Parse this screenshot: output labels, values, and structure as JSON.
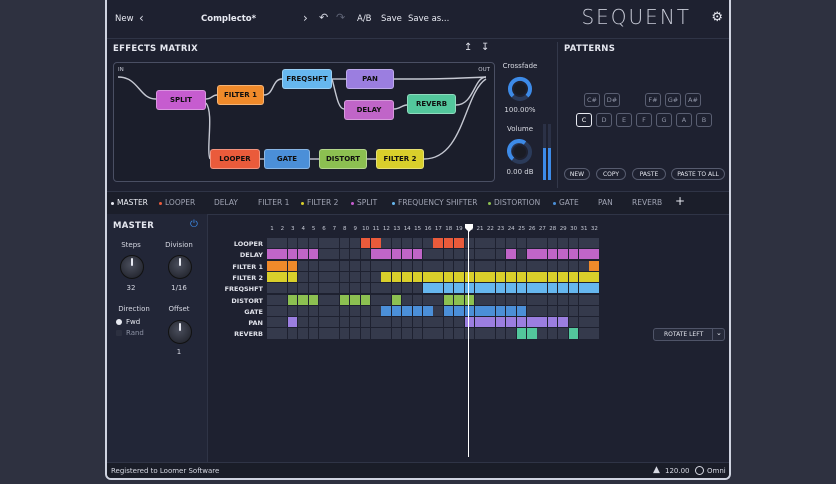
{
  "topbar": {
    "new_label": "New",
    "preset_name": "Complecto*",
    "ab_label": "A/B",
    "save_label": "Save",
    "save_as_label": "Save as...",
    "brand": "SEQUENT"
  },
  "effects_matrix": {
    "title": "EFFECTS MATRIX",
    "in_label": "IN",
    "out_label": "OUT",
    "nodes": [
      {
        "label": "SPLIT",
        "color": "#c65ccf"
      },
      {
        "label": "FILTER 1",
        "color": "#f08a2a"
      },
      {
        "label": "FREQSHFT",
        "color": "#66b7ef"
      },
      {
        "label": "PAN",
        "color": "#9b7ee0"
      },
      {
        "label": "DELAY",
        "color": "#c065c8"
      },
      {
        "label": "REVERB",
        "color": "#53c79c"
      },
      {
        "label": "LOOPER",
        "color": "#ea5b3b"
      },
      {
        "label": "GATE",
        "color": "#4b8fd8"
      },
      {
        "label": "DISTORT",
        "color": "#8cc051"
      },
      {
        "label": "FILTER 2",
        "color": "#d9cf2b"
      }
    ]
  },
  "crossfade": {
    "label": "Crossfade",
    "value": "100.00%"
  },
  "volume": {
    "label": "Volume",
    "value": "0.00 dB"
  },
  "patterns": {
    "title": "PATTERNS",
    "black_keys": [
      "C#",
      "D#",
      "F#",
      "G#",
      "A#"
    ],
    "white_keys": [
      "C",
      "D",
      "E",
      "F",
      "G",
      "A",
      "B"
    ],
    "buttons": [
      "NEW",
      "COPY",
      "PASTE",
      "PASTE TO ALL"
    ]
  },
  "tabs": [
    {
      "label": "MASTER",
      "color": "#e8eaf2"
    },
    {
      "label": "LOOPER",
      "color": "#ea5b3b"
    },
    {
      "label": "DELAY",
      "color": ""
    },
    {
      "label": "FILTER 1",
      "color": ""
    },
    {
      "label": "FILTER 2",
      "color": "#d9cf2b"
    },
    {
      "label": "SPLIT",
      "color": "#c65ccf"
    },
    {
      "label": "FREQUENCY SHIFTER",
      "color": "#66b7ef"
    },
    {
      "label": "DISTORTION",
      "color": "#8cc051"
    },
    {
      "label": "GATE",
      "color": "#4b8fd8"
    },
    {
      "label": "PAN",
      "color": ""
    },
    {
      "label": "REVERB",
      "color": ""
    }
  ],
  "master": {
    "title": "MASTER",
    "steps_label": "Steps",
    "steps_value": "32",
    "division_label": "Division",
    "division_value": "1/16",
    "direction_label": "Direction",
    "dir_fwd": "Fwd",
    "dir_rand": "Rand",
    "offset_label": "Offset",
    "offset_value": "1"
  },
  "sequencer": {
    "rows": [
      {
        "label": "LOOPER",
        "color": "#ea5b3b",
        "on": [
          10,
          11,
          17,
          18,
          19
        ]
      },
      {
        "label": "DELAY",
        "color": "#c065c8",
        "on": [
          1,
          2,
          3,
          4,
          5,
          11,
          12,
          13,
          14,
          15,
          24,
          26,
          27,
          28,
          29,
          30,
          31,
          32
        ]
      },
      {
        "label": "FILTER 1",
        "color": "#f08a2a",
        "on": [
          1,
          2,
          3,
          32
        ]
      },
      {
        "label": "FILTER 2",
        "color": "#d9cf2b",
        "on": [
          1,
          2,
          3,
          12,
          13,
          14,
          15,
          16,
          17,
          18,
          19,
          20,
          21,
          22,
          23,
          24,
          25,
          26,
          27,
          28,
          29,
          30,
          31,
          32
        ]
      },
      {
        "label": "FREQSHFT",
        "color": "#66b7ef",
        "on": [
          16,
          17,
          18,
          19,
          20,
          21,
          22,
          23,
          24,
          25,
          26,
          27,
          28,
          29,
          30,
          31,
          32
        ]
      },
      {
        "label": "DISTORT",
        "color": "#8cc051",
        "on": [
          3,
          4,
          5,
          8,
          9,
          10,
          13,
          18,
          19,
          20
        ]
      },
      {
        "label": "GATE",
        "color": "#4b8fd8",
        "on": [
          12,
          13,
          14,
          15,
          16,
          18,
          19,
          20,
          21,
          22,
          23,
          24,
          25
        ]
      },
      {
        "label": "PAN",
        "color": "#9b7ee0",
        "on": [
          3,
          20,
          21,
          22,
          23,
          24,
          25,
          26,
          27,
          28,
          29
        ]
      },
      {
        "label": "REVERB",
        "color": "#53c79c",
        "on": [
          25,
          26,
          30
        ]
      }
    ],
    "rotate_label": "ROTATE LEFT"
  },
  "statusbar": {
    "registered": "Registered to Loomer Software",
    "tempo": "120.00",
    "omni": "Omni"
  }
}
